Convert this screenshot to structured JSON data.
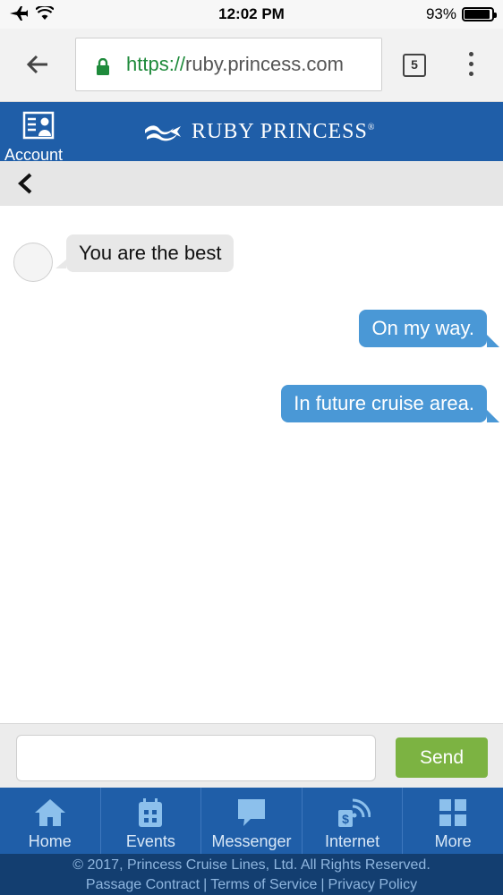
{
  "status_bar": {
    "time": "12:02 PM",
    "battery_percent": "93%",
    "battery_level": 0.93
  },
  "browser": {
    "url_scheme": "https://",
    "url_host": "ruby.princess.com",
    "tab_count": "5"
  },
  "header": {
    "account_label": "Account",
    "brand_name": "RUBY PRINCESS",
    "brand_mark": "®"
  },
  "chat": {
    "messages": [
      {
        "direction": "incoming",
        "text": "You are the best"
      },
      {
        "direction": "outgoing",
        "text": "On my way."
      },
      {
        "direction": "outgoing",
        "text": "In future cruise area."
      }
    ]
  },
  "composer": {
    "input_value": "",
    "send_label": "Send"
  },
  "nav": {
    "items": [
      {
        "label": "Home",
        "icon": "home-icon"
      },
      {
        "label": "Events",
        "icon": "calendar-icon"
      },
      {
        "label": "Messenger",
        "icon": "chat-bubble-icon"
      },
      {
        "label": "Internet",
        "icon": "wifi-dollar-icon"
      },
      {
        "label": "More",
        "icon": "grid-icon"
      }
    ]
  },
  "footer": {
    "copyright": "© 2017, Princess Cruise Lines, Ltd. All Rights Reserved.",
    "links": [
      "Passage Contract",
      "Terms of Service",
      "Privacy Policy"
    ],
    "separator": "|"
  },
  "colors": {
    "header_blue": "#1f5ea8",
    "footer_navy": "#133e70",
    "outgoing_bubble": "#4a98d6",
    "incoming_bubble": "#e8e8e8",
    "send_green": "#7cb342",
    "lock_green": "#1e8a3b"
  }
}
